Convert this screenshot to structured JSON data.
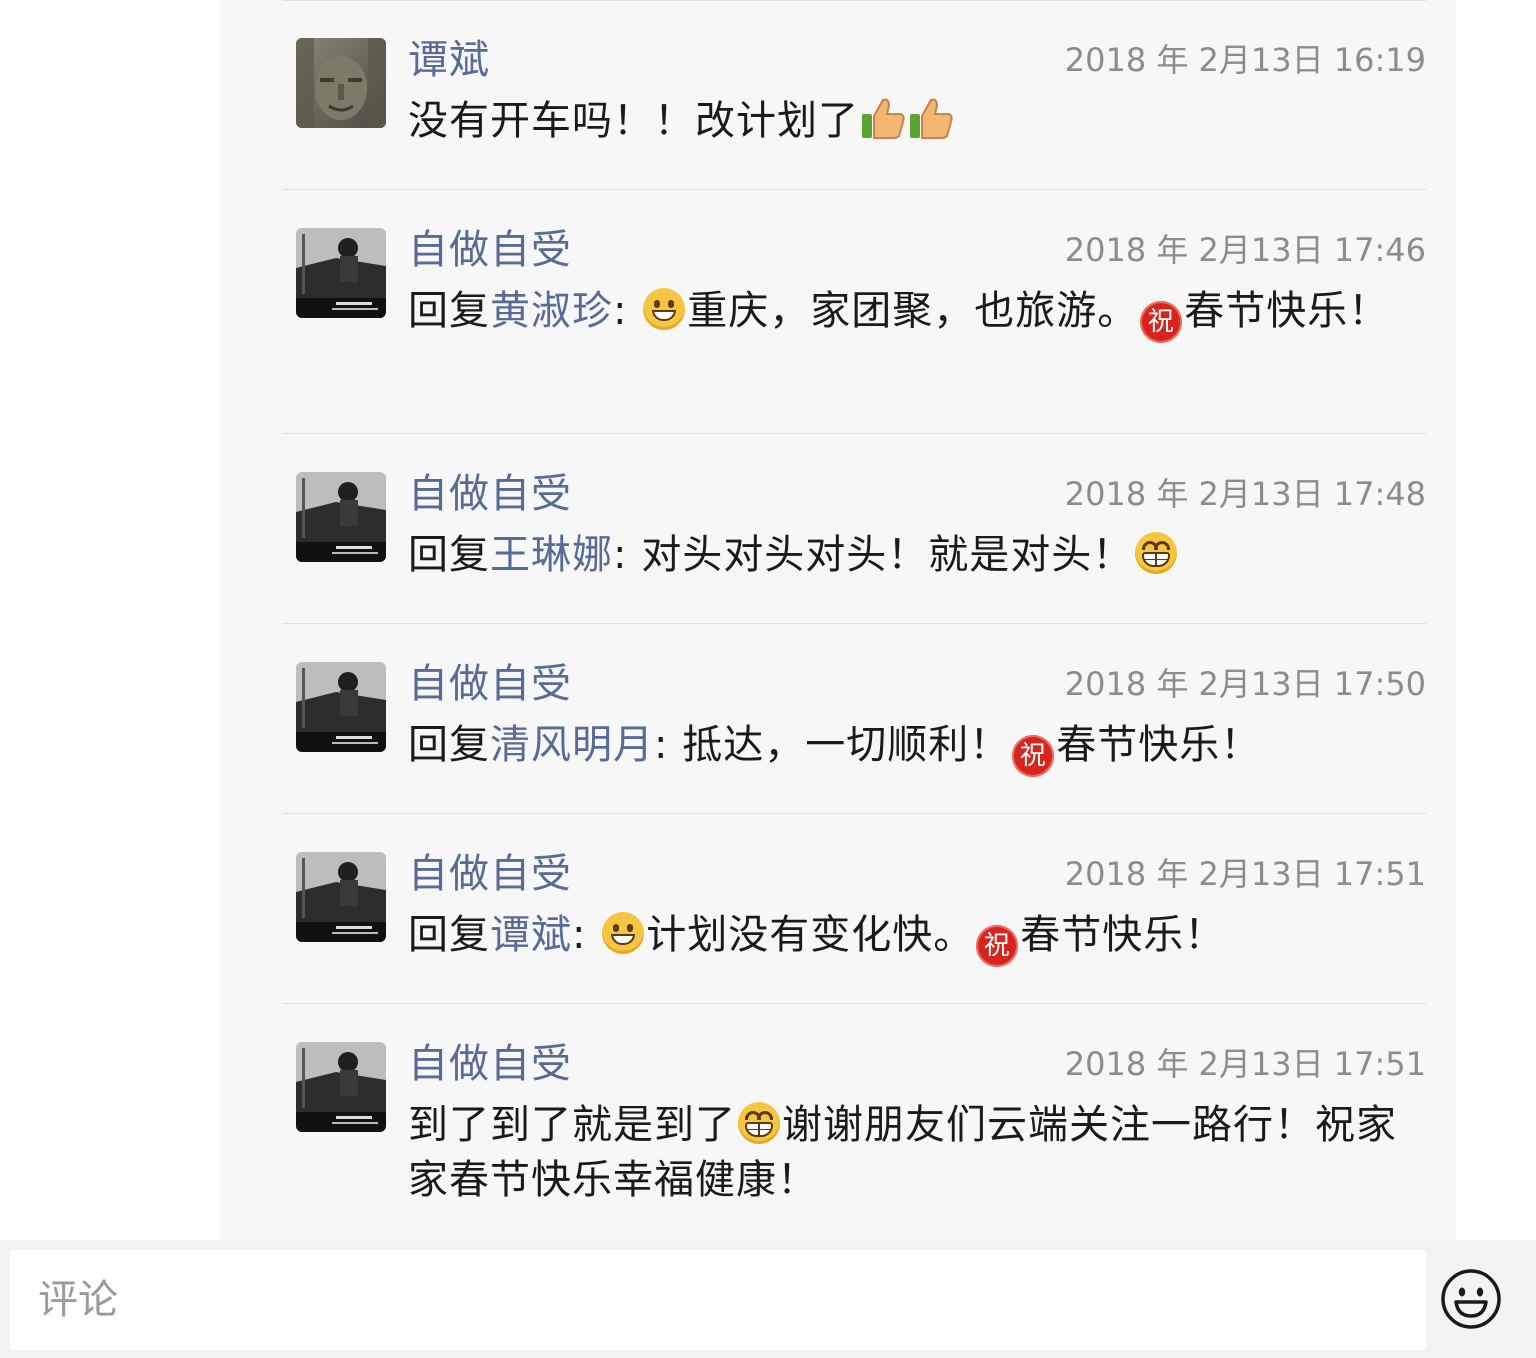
{
  "comments": [
    {
      "avatar_icon": "stone-face-avatar",
      "name": "谭斌",
      "time": "2018 年 2月13日 16:19",
      "text": "没有开车吗！！改计划了",
      "trailing_emojis": [
        "thumbs-up",
        "thumbs-up"
      ]
    },
    {
      "avatar_icon": "photo-avatar",
      "name": "自做自受",
      "time": "2018 年 2月13日 17:46",
      "reply_prefix": "回复",
      "reply_to": "黄淑珍",
      "colon": ":",
      "part1": "重庆，家团聚，也旅游。",
      "part2": "春节快乐！",
      "emojis": [
        "smile",
        "zhu"
      ]
    },
    {
      "avatar_icon": "photo-avatar",
      "name": "自做自受",
      "time": "2018 年 2月13日 17:48",
      "reply_prefix": "回复",
      "reply_to": "王琳娜",
      "colon": ":",
      "part1": " 对头对头对头！就是对头！",
      "emojis": [
        "grin"
      ]
    },
    {
      "avatar_icon": "photo-avatar",
      "name": "自做自受",
      "time": "2018 年 2月13日 17:50",
      "reply_prefix": "回复",
      "reply_to": "清风明月",
      "colon": ":",
      "part1": " 抵达，一切顺利！",
      "part2": "春节快乐！",
      "emojis": [
        "zhu"
      ]
    },
    {
      "avatar_icon": "photo-avatar",
      "name": "自做自受",
      "time": "2018 年 2月13日 17:51",
      "reply_prefix": "回复",
      "reply_to": "谭斌",
      "colon": ":",
      "part1": "计划没有变化快。",
      "part2": "春节快乐！",
      "emojis": [
        "smile",
        "zhu"
      ]
    },
    {
      "avatar_icon": "photo-avatar",
      "name": "自做自受",
      "time": "2018 年 2月13日 17:51",
      "part1": "到了到了就是到了",
      "part2": "谢谢朋友们云端关注一路行！祝家家春节快乐幸福健康！",
      "emojis": [
        "grin"
      ]
    }
  ],
  "zhu_glyph": "祝",
  "input": {
    "placeholder": "评论",
    "emoji_button_icon": "smiley-face-icon"
  },
  "colors": {
    "name_link": "#576b95",
    "timestamp": "#8c8c8c",
    "panel_bg": "#f7f7f7"
  }
}
